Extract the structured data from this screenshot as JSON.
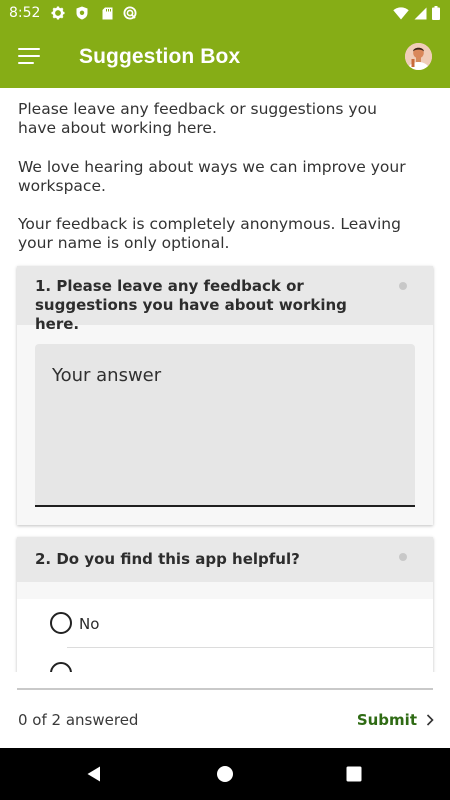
{
  "status_bar": {
    "time": "8:52",
    "left_icons": [
      "gear-icon",
      "shield-icon",
      "sd-card-icon",
      "sync-icon"
    ],
    "right_icons": [
      "wifi-icon",
      "signal-icon",
      "battery-icon"
    ]
  },
  "app_bar": {
    "title": "Suggestion Box",
    "menu_icon": "hamburger-menu-icon",
    "avatar": "user-avatar"
  },
  "intro": {
    "p1": "Please leave any feedback or suggestions you have about working here.",
    "p2": "We love hearing about ways we can improve your workspace.",
    "p3": "Your feedback is completely anonymous. Leaving your name is only optional."
  },
  "questions": [
    {
      "title": "1. Please leave any feedback or suggestions you have about working here.",
      "placeholder": "Your answer"
    },
    {
      "title": "2. Do you find this app helpful?",
      "options": [
        "No",
        ""
      ]
    }
  ],
  "footer": {
    "progress": "0 of 2 answered",
    "answered": 0,
    "total": 2,
    "submit_label": "Submit"
  },
  "nav_bar": {
    "icons": [
      "back-triangle-icon",
      "home-circle-icon",
      "recents-square-icon"
    ]
  },
  "colors": {
    "brand": "#86ad16",
    "submit": "#2f6b14",
    "card_header": "#e8e8e8",
    "input_fill": "#e6e6e6"
  }
}
